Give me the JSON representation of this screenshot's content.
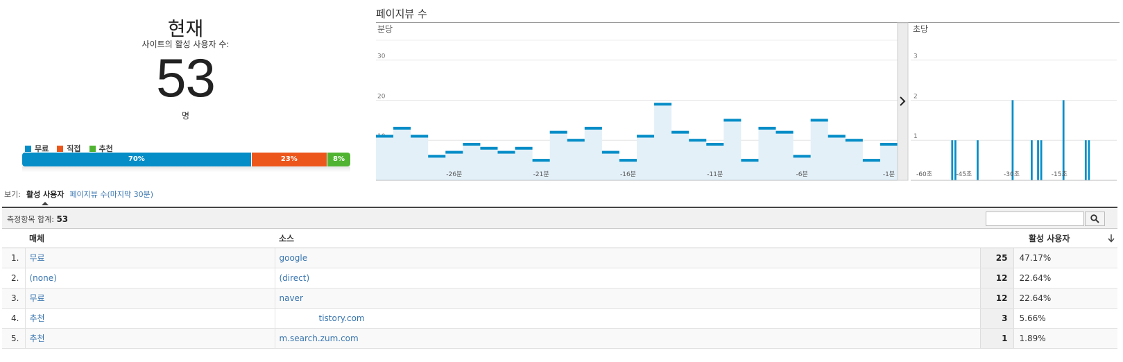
{
  "summary": {
    "title": "현재",
    "subtitle": "사이트의 활성 사용자 수:",
    "count": "53",
    "unit": "명",
    "legend": [
      {
        "label": "무료",
        "color": "#058dc7"
      },
      {
        "label": "직접",
        "color": "#ed561b"
      },
      {
        "label": "추천",
        "color": "#50b432"
      }
    ],
    "segments": [
      {
        "label": "70%",
        "share": 0.7,
        "color": "#058dc7"
      },
      {
        "label": "23%",
        "share": 0.23,
        "color": "#ed561b"
      },
      {
        "label": "8%",
        "share": 0.07,
        "color": "#50b432"
      }
    ]
  },
  "pageviews": {
    "title": "페이지뷰 수",
    "per_minute_label": "분당",
    "per_second_label": "초당",
    "toggle_icon": "chevron-right-icon"
  },
  "chart_data": [
    {
      "type": "bar",
      "title": "분당",
      "ylim": [
        0,
        36
      ],
      "yticks": [
        "10",
        "20",
        "30"
      ],
      "xticks": [
        {
          "label": "-26분",
          "index": 4
        },
        {
          "label": "-21분",
          "index": 9
        },
        {
          "label": "-16분",
          "index": 14
        },
        {
          "label": "-11분",
          "index": 19
        },
        {
          "label": "-6분",
          "index": 24
        },
        {
          "label": "-1분",
          "index": 29
        }
      ],
      "values": [
        11,
        13,
        11,
        6,
        7,
        9,
        8,
        7,
        8,
        5,
        12,
        10,
        13,
        7,
        5,
        11,
        19,
        12,
        10,
        9,
        15,
        5,
        13,
        12,
        6,
        15,
        11,
        10,
        5,
        9
      ],
      "color": "#058dc7"
    },
    {
      "type": "bar",
      "title": "초당",
      "ylim": [
        0,
        3.6
      ],
      "yticks": [
        "1",
        "2",
        "3"
      ],
      "xticks": [
        {
          "label": "-60초",
          "index": 0
        },
        {
          "label": "-45초",
          "index": 15
        },
        {
          "label": "-30초",
          "index": 30
        },
        {
          "label": "-15초",
          "index": 45
        }
      ],
      "values": [
        0,
        0,
        0,
        0,
        0,
        0,
        0,
        0,
        0,
        0,
        0,
        1,
        1,
        0,
        0,
        0,
        0,
        0,
        0,
        1,
        0,
        0,
        0,
        0,
        0,
        0,
        0,
        0,
        0,
        0,
        2,
        0,
        0,
        0,
        0,
        0,
        1,
        0,
        1,
        1,
        0,
        0,
        0,
        0,
        0,
        0,
        2,
        0,
        0,
        0,
        0,
        0,
        0,
        1,
        1,
        0,
        0,
        0,
        0,
        0
      ],
      "color": "#058dc7"
    }
  ],
  "tabs": {
    "view_label": "보기:",
    "active": "활성 사용자",
    "other": "페이지뷰 수(마지막 30분)"
  },
  "table": {
    "totals_label": "측정항목 합계:",
    "totals_value": "53",
    "search_placeholder": "",
    "search_icon": "search-icon",
    "headers": {
      "medium": "매체",
      "source": "소스",
      "metric": "활성 사용자",
      "sort_icon": "arrow-down-icon"
    },
    "rows": [
      {
        "index": "1.",
        "medium": "무료",
        "source": "google",
        "value": "25",
        "pct": "47.17%"
      },
      {
        "index": "2.",
        "medium": "(none)",
        "source": "(direct)",
        "value": "12",
        "pct": "22.64%"
      },
      {
        "index": "3.",
        "medium": "무료",
        "source": "naver",
        "value": "12",
        "pct": "22.64%"
      },
      {
        "index": "4.",
        "medium": "추천",
        "source": "tistory.com",
        "value": "3",
        "pct": "5.66%"
      },
      {
        "index": "5.",
        "medium": "추천",
        "source": "m.search.zum.com",
        "value": "1",
        "pct": "1.89%"
      }
    ]
  }
}
